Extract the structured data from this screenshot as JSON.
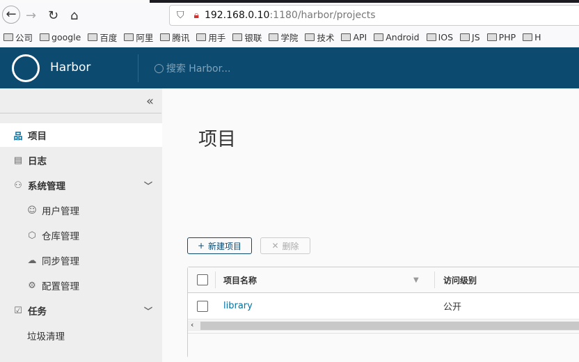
{
  "browser": {
    "url_host": "192.168.0.10",
    "url_rest": ":1180/harbor/projects",
    "bookmarks": [
      "公司",
      "google",
      "百度",
      "阿里",
      "腾讯",
      "用手",
      "银联",
      "学院",
      "技术",
      "API",
      "Android",
      "IOS",
      "JS",
      "PHP",
      "H"
    ]
  },
  "header": {
    "brand": "Harbor",
    "search_placeholder": "搜索 Harbor..."
  },
  "sidebar": {
    "items": [
      {
        "label": "项目",
        "icon": "projects-icon",
        "active": true
      },
      {
        "label": "日志",
        "icon": "logs-icon"
      },
      {
        "label": "系统管理",
        "icon": "admin-icon"
      },
      {
        "label": "用户管理",
        "icon": "users-icon"
      },
      {
        "label": "仓库管理",
        "icon": "registry-icon"
      },
      {
        "label": "同步管理",
        "icon": "replication-icon"
      },
      {
        "label": "配置管理",
        "icon": "config-icon"
      },
      {
        "label": "任务",
        "icon": "tasks-icon"
      },
      {
        "label": "垃圾清理"
      }
    ]
  },
  "main": {
    "title": "项目",
    "new_button": "新建项目",
    "delete_button": "删除",
    "table": {
      "columns": [
        "项目名称",
        "访问级别"
      ],
      "rows": [
        {
          "name": "library",
          "access": "公开"
        }
      ]
    }
  },
  "colors": {
    "header": "#0d4a70",
    "link": "#0072a3"
  }
}
